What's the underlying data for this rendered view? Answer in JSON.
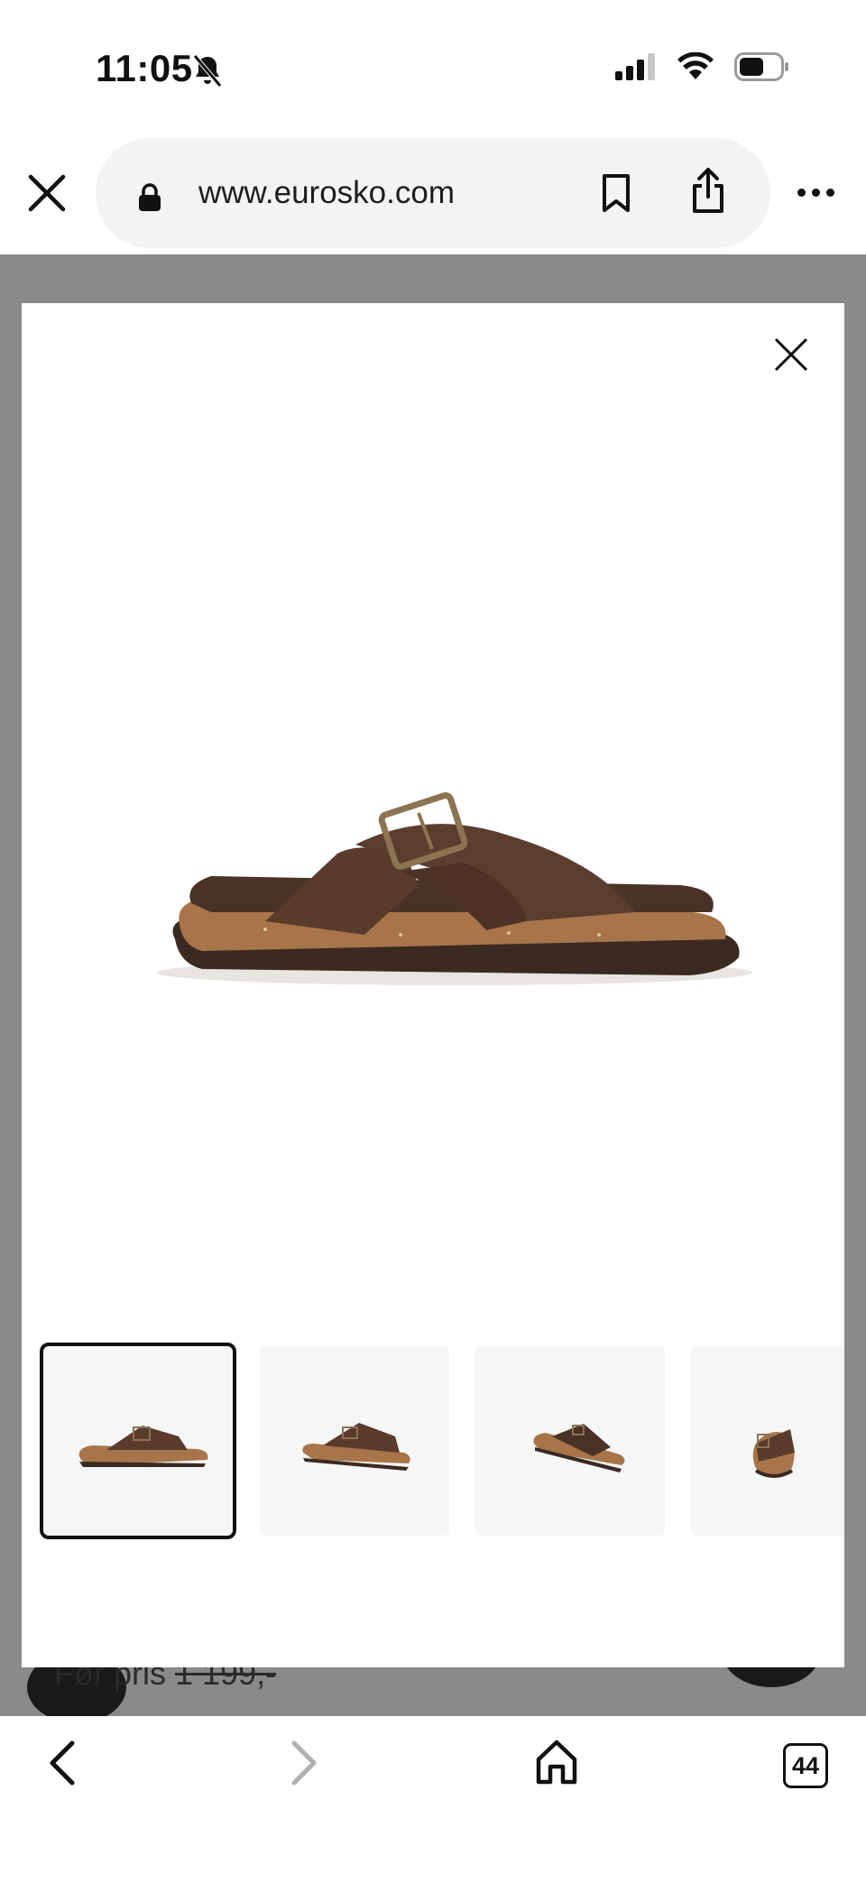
{
  "status_bar": {
    "time": "11:05",
    "icons": [
      "bell-slash-icon",
      "cellular-signal-icon",
      "wifi-icon",
      "battery-icon"
    ]
  },
  "browser": {
    "url": "www.eurosko.com",
    "icons": [
      "close-icon",
      "lock-icon",
      "bookmark-icon",
      "share-icon",
      "more-icon"
    ]
  },
  "background_page": {
    "price_label": "Før pris",
    "old_price": "1 199,-"
  },
  "gallery": {
    "main_image_alt": "Brown leather cross-strap sandal",
    "thumbnails": [
      {
        "id": 1,
        "active": true
      },
      {
        "id": 2,
        "active": false
      },
      {
        "id": 3,
        "active": false
      },
      {
        "id": 4,
        "active": false
      }
    ]
  },
  "bottom_nav": {
    "tabs_count": "44",
    "icons": [
      "back-icon",
      "forward-icon",
      "home-icon",
      "tabs-icon"
    ]
  },
  "colors": {
    "dim_overlay": "#8a8a8a",
    "sandal_leather": "#5a3b2c",
    "cork": "#a8754a"
  }
}
